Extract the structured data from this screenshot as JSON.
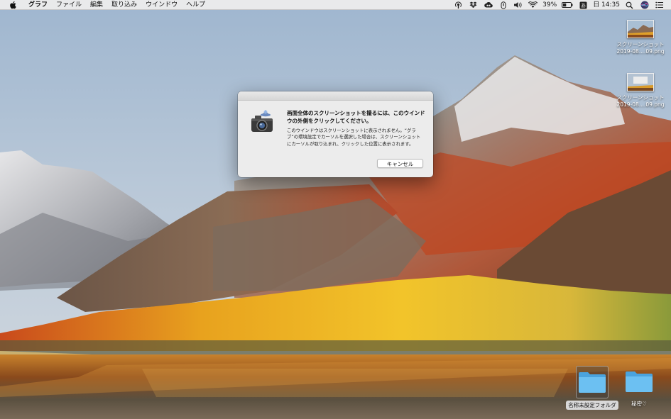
{
  "menubar": {
    "app_name": "グラフ",
    "items": [
      "ファイル",
      "編集",
      "取り込み",
      "ウインドウ",
      "ヘルプ"
    ],
    "battery": "39%",
    "time": "日 14:35"
  },
  "desktop": {
    "files": [
      {
        "line1": "スクリーンショット",
        "line2": "2019-08....09.png"
      },
      {
        "line1": "スクリーンショット",
        "line2": "2019-08....09.png"
      }
    ],
    "folders": [
      {
        "label": "名称未設定フォルダ",
        "selected": true
      },
      {
        "label": "秘密♡",
        "selected": false
      }
    ]
  },
  "dialog": {
    "heading": "画面全体のスクリーンショットを撮るには、このウインドウの外側をクリックしてください。",
    "body": "このウインドウはスクリーンショットに表示されません。“グラブ”の環境設定でカーソルを選択した場合は、スクリーンショットにカーソルが取り込まれ、クリックした位置に表示されます。",
    "cancel_label": "キャンセル"
  },
  "colors": {
    "folder_blue": "#5fb4ec",
    "menubar_bg": "#ececec",
    "dialog_bg": "#ececec"
  }
}
